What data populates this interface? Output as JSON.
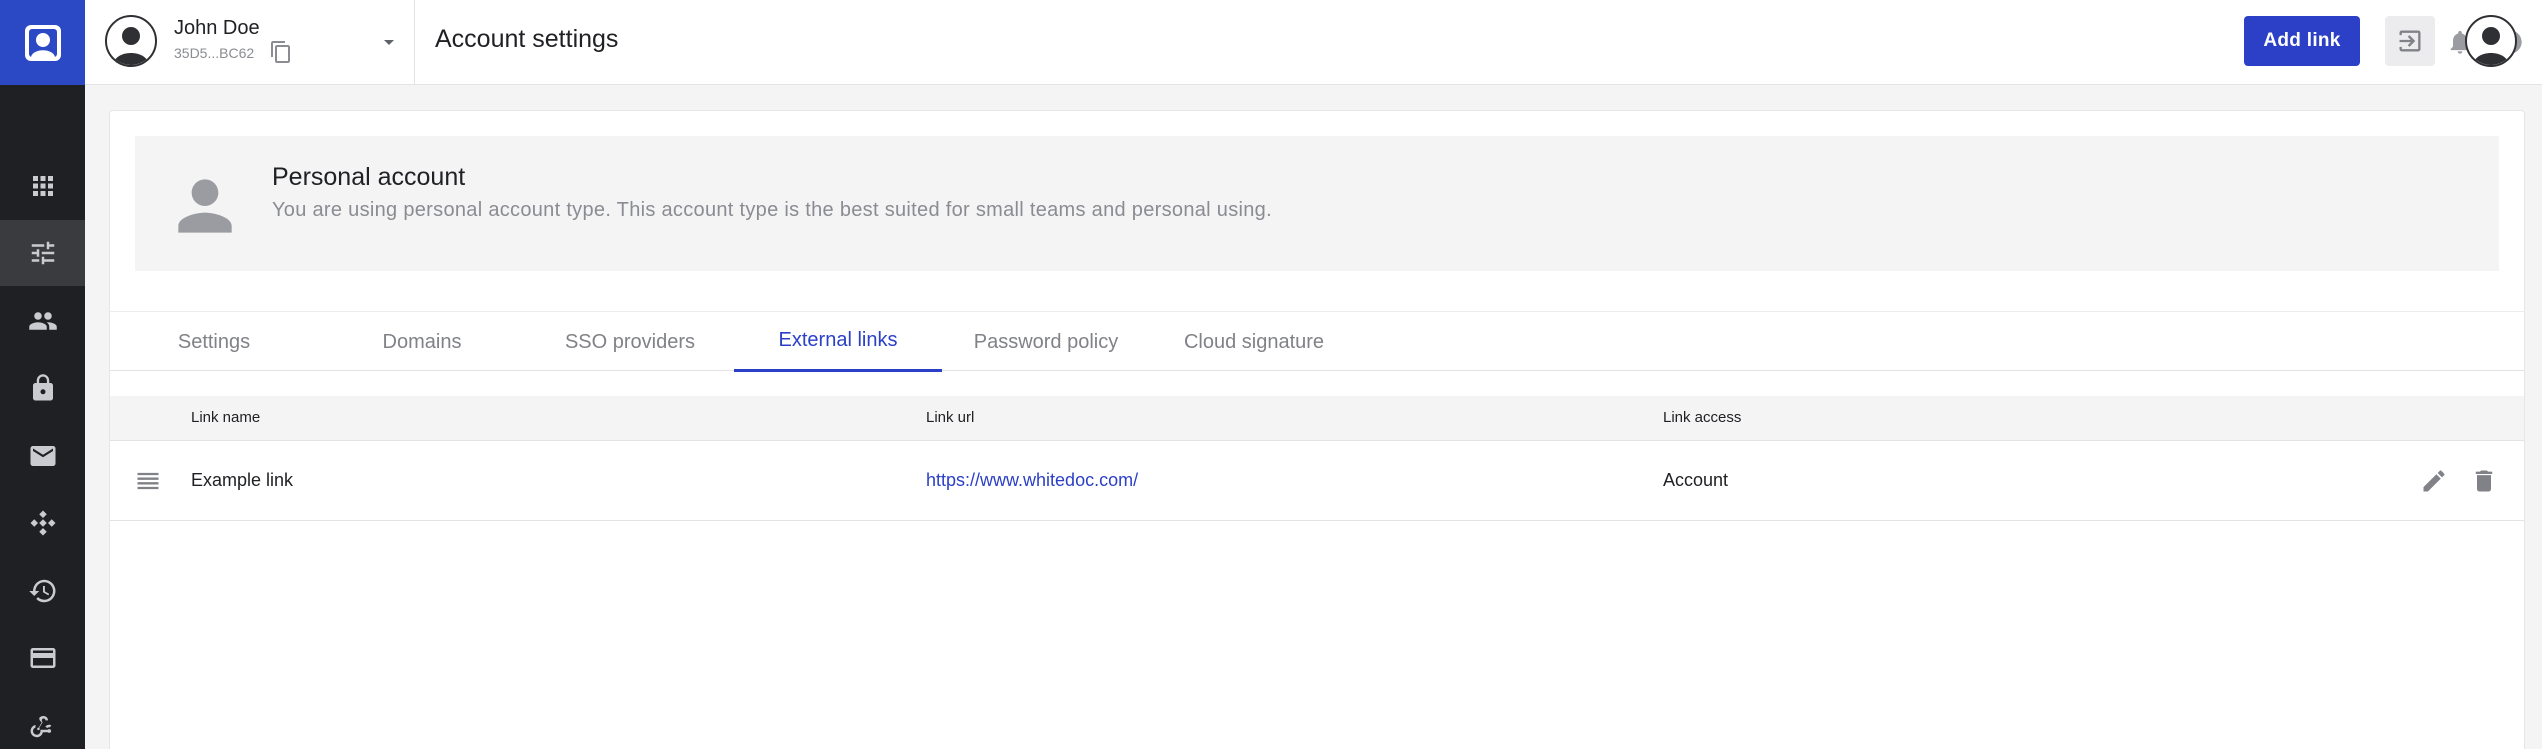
{
  "header": {
    "user_name": "John Doe",
    "user_id": "35D5...BC62",
    "page_title": "Account settings",
    "add_link_label": "Add link"
  },
  "sidebar": {
    "items": [
      {
        "icon": "apps-icon"
      },
      {
        "icon": "tune-icon",
        "active": true
      },
      {
        "icon": "people-icon"
      },
      {
        "icon": "lock-icon"
      },
      {
        "icon": "mail-icon"
      },
      {
        "icon": "workflow-icon"
      },
      {
        "icon": "history-icon"
      },
      {
        "icon": "credit-card-icon"
      },
      {
        "icon": "webhook-icon"
      }
    ]
  },
  "account": {
    "title": "Personal account",
    "description": "You are using personal account type. This account type is the best suited for small teams and personal using."
  },
  "tabs": [
    {
      "label": "Settings"
    },
    {
      "label": "Domains"
    },
    {
      "label": "SSO providers"
    },
    {
      "label": "External links",
      "active": true
    },
    {
      "label": "Password policy"
    },
    {
      "label": "Cloud signature"
    }
  ],
  "table": {
    "columns": [
      "Link name",
      "Link url",
      "Link access"
    ],
    "rows": [
      {
        "name": "Example link",
        "url": "https://www.whitedoc.com/",
        "access": "Account"
      }
    ]
  },
  "colors": {
    "accent": "#2b3fc7",
    "rail_bg": "#1f2023",
    "logo_bg": "#2b49c4"
  }
}
